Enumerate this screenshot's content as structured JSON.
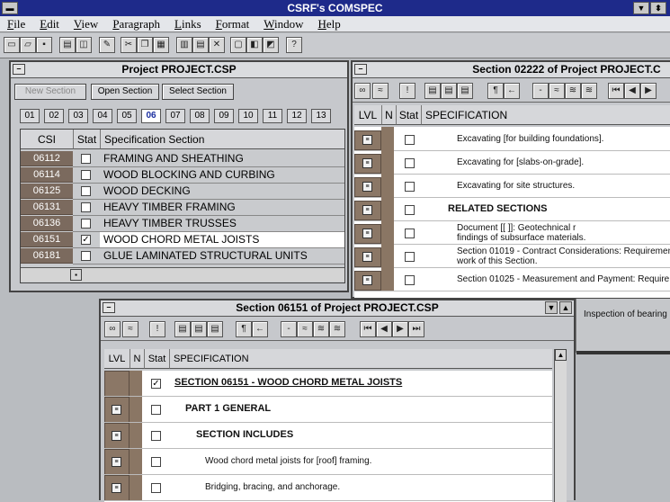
{
  "app": {
    "title": "CSRF's COMSPEC"
  },
  "menu": [
    "File",
    "Edit",
    "View",
    "Paragraph",
    "Links",
    "Format",
    "Window",
    "Help"
  ],
  "project_window": {
    "title": "Project PROJECT.CSP",
    "buttons": {
      "new": "New Section",
      "open": "Open Section",
      "select": "Select Section"
    },
    "division_tabs": [
      "01",
      "02",
      "03",
      "04",
      "05",
      "06",
      "07",
      "08",
      "09",
      "10",
      "11",
      "12",
      "13"
    ],
    "selected_tab": "06",
    "headers": {
      "csi": "CSI",
      "stat": "Stat",
      "spec": "Specification Section"
    },
    "rows": [
      {
        "csi": "06112",
        "checked": false,
        "spec": "FRAMING AND SHEATHING"
      },
      {
        "csi": "06114",
        "checked": false,
        "spec": "WOOD BLOCKING AND CURBING"
      },
      {
        "csi": "06125",
        "checked": false,
        "spec": "WOOD DECKING"
      },
      {
        "csi": "06131",
        "checked": false,
        "spec": "HEAVY TIMBER FRAMING"
      },
      {
        "csi": "06136",
        "checked": false,
        "spec": "HEAVY TIMBER TRUSSES"
      },
      {
        "csi": "06151",
        "checked": true,
        "spec": "WOOD CHORD METAL JOISTS",
        "selected": true
      },
      {
        "csi": "06181",
        "checked": false,
        "spec": "GLUE LAMINATED STRUCTURAL UNITS"
      }
    ]
  },
  "section_02222": {
    "title": "Section 02222 of Project PROJECT.C",
    "headers": {
      "lvl": "LVL",
      "n": "N",
      "stat": "Stat",
      "spec": "SPECIFICATION"
    },
    "rows": [
      {
        "text": "Excavating [for building foundations].",
        "style": "small"
      },
      {
        "text": "Excavating for [slabs-on-grade].",
        "style": "small"
      },
      {
        "text": "Excavating for site structures.",
        "style": "small"
      },
      {
        "text": "RELATED SECTIONS",
        "style": "heading"
      },
      {
        "text": "Document [[ ]]: Geotechnical r",
        "text2": "findings of subsurface materials.",
        "style": "small"
      },
      {
        "text": "Section 01019 - Contract Considerations: Requiremen",
        "text2": "work of this Section.",
        "style": "small"
      },
      {
        "text": "Section 01025 - Measurement and Payment: Require",
        "text2": "",
        "style": "small"
      }
    ],
    "peek_text": "Inspection of bearing"
  },
  "section_06151": {
    "title": "Section 06151 of Project PROJECT.CSP",
    "headers": {
      "lvl": "LVL",
      "n": "N",
      "stat": "Stat",
      "spec": "SPECIFICATION"
    },
    "rows": [
      {
        "text": "SECTION 06151 - WOOD CHORD METAL JOISTS",
        "style": "title",
        "checked": true
      },
      {
        "text": "PART 1  GENERAL",
        "style": "part",
        "checked": false
      },
      {
        "text": "SECTION INCLUDES",
        "style": "heading",
        "checked": false
      },
      {
        "text": "Wood chord metal joists for [roof] framing.",
        "style": "small",
        "checked": false
      },
      {
        "text": "Bridging, bracing, and anchorage.",
        "style": "small",
        "checked": false
      }
    ]
  }
}
